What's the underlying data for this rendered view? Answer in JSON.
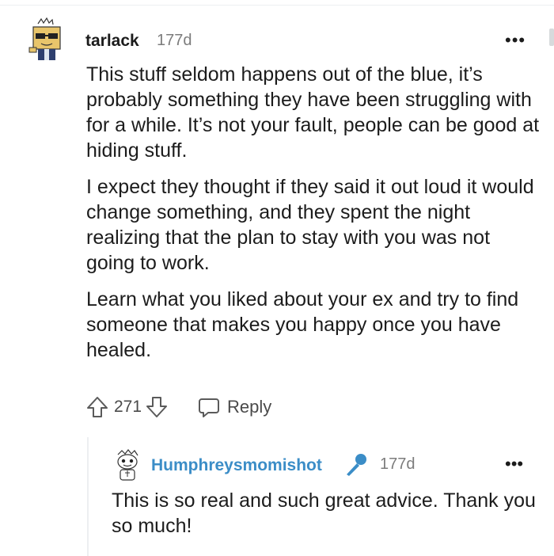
{
  "comment": {
    "author": "tarlack",
    "time": "177d",
    "more_label": "•••",
    "paragraphs": [
      "This stuff seldom happens out of the blue, it’s probably something they have been struggling with for a while. It’s not your fault, people can be good at hiding stuff.",
      "I expect they thought if they said it out loud it would change something, and they spent the night realizing that the plan to stay with you was not going to work.",
      "Learn what you liked about your ex and try to find someone that makes you happy once you have healed."
    ],
    "score": "271",
    "reply_label": "Reply",
    "icons": [
      "upvote-icon",
      "downvote-icon",
      "comment-bubble-icon",
      "more-icon"
    ]
  },
  "reply": {
    "author": "Humphreysmomishot",
    "time": "177d",
    "more_label": "•••",
    "body": "This is so real and such great advice. Thank you so much!",
    "icons": [
      "microphone-icon"
    ],
    "colors": {
      "author": "#3b8dc7",
      "mic": "#3b8dc7"
    }
  }
}
